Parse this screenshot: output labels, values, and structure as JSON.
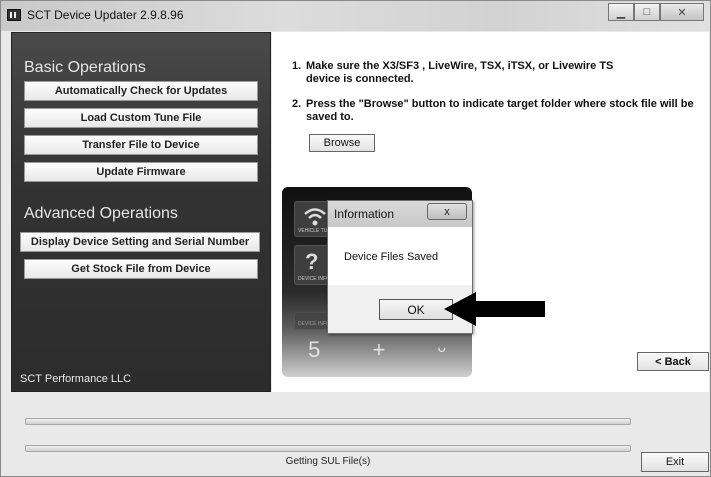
{
  "window": {
    "title": "SCT Device Updater 2.9.8.96"
  },
  "left": {
    "basic_title": "Basic Operations",
    "basic_buttons": [
      "Automatically Check for Updates",
      "Load Custom Tune File",
      "Transfer File to Device",
      "Update Firmware"
    ],
    "advanced_title": "Advanced Operations",
    "advanced_buttons": [
      "Display Device Setting and Serial Number",
      "Get Stock File from Device"
    ],
    "company": "SCT Performance LLC"
  },
  "instructions": {
    "step1_num": "1.",
    "step1_line1": "Make sure the X3/SF3 , LiveWire, TSX, iTSX, or Livewire TS",
    "step1_line2": "device is connected.",
    "step2_num": "2.",
    "step2_line1": "Press the \"Browse\" button to indicate target folder where stock file will be",
    "step2_line2": "saved to.",
    "browse_label": "Browse"
  },
  "device": {
    "tile1_label": "VEHICLE TU",
    "tile2_label": "DEVICE INFOR",
    "tile3_label": "DEVICE INFO"
  },
  "dialog": {
    "title": "Information",
    "close_label": "x",
    "message": "Device Files Saved",
    "ok_label": "OK"
  },
  "back_label": "< Back",
  "status_text": "Getting SUL File(s)",
  "exit_label": "Exit"
}
